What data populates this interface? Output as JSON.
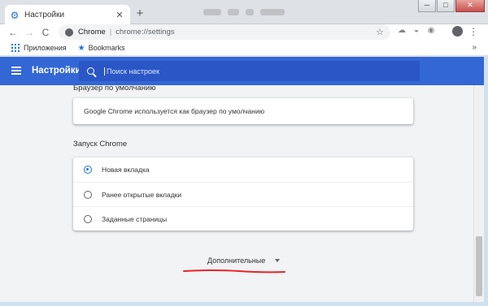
{
  "tab": {
    "title": "Настройки",
    "close": "✕"
  },
  "new_tab": "+",
  "window": {
    "minimize": "─",
    "maximize": "□",
    "close": "✕"
  },
  "toolbar": {
    "back": "←",
    "forward": "→",
    "reload": "C",
    "host": "Chrome",
    "separator": "|",
    "url": "chrome://settings",
    "bookmark_star": "☆",
    "menu": "⋮"
  },
  "bookmarks": {
    "apps_label": "Приложения",
    "bookmarks_label": "Bookmarks",
    "more": "»"
  },
  "settings": {
    "title": "Настройки",
    "search_placeholder": "Поиск настроек"
  },
  "default_browser": {
    "heading": "Браузер по умолчанию",
    "status": "Google Chrome используется как браузер по умолчанию"
  },
  "startup": {
    "heading": "Запуск Chrome",
    "options": [
      {
        "label": "Новая вкладка",
        "checked": true
      },
      {
        "label": "Ранее открытые вкладки",
        "checked": false
      },
      {
        "label": "Заданные страницы",
        "checked": false
      }
    ]
  },
  "advanced": {
    "label": "Дополнительные"
  },
  "colors": {
    "accent": "#1a73e8",
    "header": "#3367d6",
    "annotation": "#e8232a"
  }
}
